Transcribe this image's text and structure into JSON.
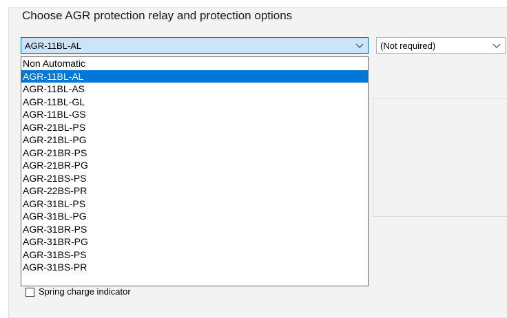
{
  "dialog": {
    "title": "Choose AGR protection relay and protection options"
  },
  "relay_combo": {
    "selected": "AGR-11BL-AL",
    "icon": "chevron-down-icon"
  },
  "option_combo": {
    "selected": "(Not required)",
    "icon": "chevron-down-icon"
  },
  "relay_list": {
    "items": [
      "Non Automatic",
      "AGR-11BL-AL",
      "AGR-11BL-AS",
      "AGR-11BL-GL",
      "AGR-11BL-GS",
      "AGR-21BL-PS",
      "AGR-21BL-PG",
      "AGR-21BR-PS",
      "AGR-21BR-PG",
      "AGR-21BS-PS",
      "AGR-22BS-PR",
      "AGR-31BL-PS",
      "AGR-31BL-PG",
      "AGR-31BR-PS",
      "AGR-31BR-PG",
      "AGR-31BS-PS",
      "AGR-31BS-PR"
    ],
    "selected_index": 1
  },
  "checkbox_spring": {
    "label": "Spring charge indicator",
    "checked": false
  },
  "colors": {
    "highlight": "#0078d7",
    "combo_focus_bg": "#cce4f7",
    "panel_bg": "#f3f3f3"
  }
}
